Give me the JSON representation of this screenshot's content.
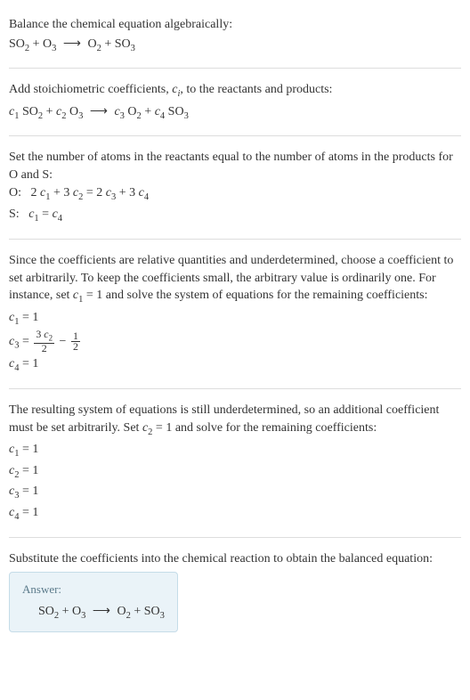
{
  "step1": {
    "intro": "Balance the chemical equation algebraically:",
    "equation": "SO₂ + O₃  ⟶  O₂ + SO₃"
  },
  "step2": {
    "intro": "Add stoichiometric coefficients, cᵢ, to the reactants and products:",
    "equation": "c₁ SO₂ + c₂ O₃  ⟶  c₃ O₂ + c₄ SO₃"
  },
  "step3": {
    "intro": "Set the number of atoms in the reactants equal to the number of atoms in the products for O and S:",
    "o_row": "O:   2 c₁ + 3 c₂ = 2 c₃ + 3 c₄",
    "s_row": "S:   c₁ = c₄"
  },
  "step4": {
    "intro": "Since the coefficients are relative quantities and underdetermined, choose a coefficient to set arbitrarily. To keep the coefficients small, the arbitrary value is ordinarily one. For instance, set c₁ = 1 and solve the system of equations for the remaining coefficients:",
    "c1": "c₁ = 1",
    "c3_lhs": "c₃ = ",
    "c3_num": "3 c₂",
    "c3_den": "2",
    "c3_mid": " − ",
    "c3_num2": "1",
    "c3_den2": "2",
    "c4": "c₄ = 1"
  },
  "step5": {
    "intro": "The resulting system of equations is still underdetermined, so an additional coefficient must be set arbitrarily. Set c₂ = 1 and solve for the remaining coefficients:",
    "c1": "c₁ = 1",
    "c2": "c₂ = 1",
    "c3": "c₃ = 1",
    "c4": "c₄ = 1"
  },
  "step6": {
    "intro": "Substitute the coefficients into the chemical reaction to obtain the balanced equation:"
  },
  "answer": {
    "label": "Answer:",
    "equation": "SO₂ + O₃  ⟶  O₂ + SO₃"
  }
}
